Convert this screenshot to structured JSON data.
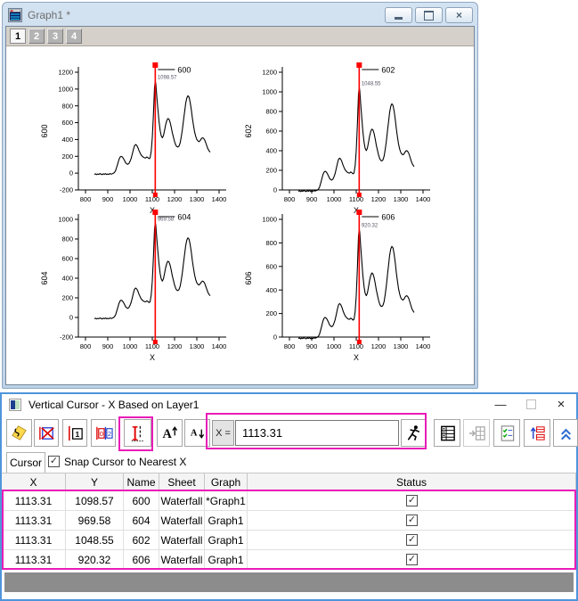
{
  "colors": {
    "highlight": "#e91cb8",
    "cursor_line": "#ff0000",
    "dialog_border": "#4f95dc"
  },
  "icons": {
    "close": "×",
    "minimize": "—",
    "check": "✓"
  },
  "graphWindow": {
    "title": "Graph1 *",
    "layerTabs": [
      "1",
      "2",
      "3",
      "4"
    ]
  },
  "chart_data": {
    "type": "line",
    "xlabel": "X",
    "xlim": [
      768,
      1432
    ],
    "xticks": [
      800,
      900,
      1000,
      1100,
      1200,
      1300,
      1400
    ],
    "cursor_x": 1113.31,
    "x": [
      840,
      845,
      850,
      855,
      860,
      865,
      870,
      875,
      880,
      885,
      890,
      895,
      900,
      905,
      910,
      915,
      920,
      925,
      930,
      935,
      940,
      945,
      950,
      955,
      960,
      965,
      970,
      975,
      980,
      985,
      990,
      995,
      1000,
      1005,
      1010,
      1015,
      1020,
      1025,
      1030,
      1035,
      1040,
      1045,
      1050,
      1055,
      1060,
      1065,
      1070,
      1075,
      1080,
      1085,
      1090,
      1095,
      1100,
      1105,
      1110,
      1113,
      1116,
      1120,
      1125,
      1130,
      1135,
      1140,
      1145,
      1150,
      1155,
      1160,
      1165,
      1170,
      1175,
      1180,
      1185,
      1190,
      1195,
      1200,
      1205,
      1210,
      1215,
      1220,
      1225,
      1230,
      1235,
      1240,
      1245,
      1250,
      1255,
      1260,
      1265,
      1270,
      1275,
      1280,
      1285,
      1290,
      1295,
      1300,
      1305,
      1310,
      1315,
      1320,
      1325,
      1330,
      1335,
      1340,
      1345,
      1350,
      1355,
      1360
    ],
    "base_y": [
      -15,
      -8,
      -18,
      -10,
      -15,
      -5,
      -12,
      -18,
      -8,
      -14,
      -6,
      -16,
      -10,
      -15,
      -5,
      -12,
      -8,
      -2,
      8,
      30,
      70,
      115,
      160,
      190,
      200,
      192,
      175,
      150,
      125,
      110,
      105,
      115,
      140,
      175,
      225,
      280,
      325,
      340,
      330,
      305,
      270,
      240,
      215,
      200,
      190,
      182,
      180,
      192,
      185,
      172,
      180,
      260,
      420,
      700,
      1020,
      1098,
      1060,
      920,
      760,
      620,
      510,
      445,
      420,
      445,
      510,
      575,
      625,
      650,
      640,
      605,
      545,
      480,
      425,
      375,
      335,
      315,
      310,
      322,
      360,
      430,
      520,
      625,
      730,
      830,
      895,
      920,
      903,
      845,
      755,
      655,
      565,
      490,
      435,
      400,
      382,
      375,
      388,
      408,
      420,
      415,
      395,
      362,
      322,
      288,
      265,
      250
    ],
    "plots": [
      {
        "name": "600",
        "ylim": [
          -200,
          1200
        ],
        "yticks": [
          -200,
          0,
          200,
          400,
          600,
          800,
          1000,
          1200
        ],
        "cursor_y": 1098.57,
        "scale": 1
      },
      {
        "name": "602",
        "ylim": [
          0,
          1200
        ],
        "yticks": [
          0,
          200,
          400,
          600,
          800,
          1000,
          1200
        ],
        "cursor_y": 1048.55,
        "scale": 0.9545
      },
      {
        "name": "604",
        "ylim": [
          -200,
          1000
        ],
        "yticks": [
          -200,
          0,
          200,
          400,
          600,
          800,
          1000
        ],
        "cursor_y": 969.58,
        "scale": 0.8826
      },
      {
        "name": "606",
        "ylim": [
          0,
          1000
        ],
        "yticks": [
          0,
          200,
          400,
          600,
          800,
          1000
        ],
        "cursor_y": 920.32,
        "scale": 0.8377
      }
    ]
  },
  "dialog": {
    "title": "Vertical Cursor - X Based on Layer1",
    "toolbar": {
      "x_label": "X =",
      "x_value": "1113.31",
      "buttons": [
        "annotation",
        "remove-label",
        "cursor-one",
        "cursor-pair",
        "vertical-cursor",
        "font-increase",
        "font-decrease",
        "go",
        "info-table",
        "output-to-worksheet",
        "preferences",
        "update-plot",
        "collapse"
      ]
    },
    "tab": "Cursor",
    "snap_label": "Snap Cursor to Nearest X",
    "snap_checked": true,
    "table": {
      "columns": [
        "X",
        "Y",
        "Name",
        "Sheet",
        "Graph",
        "Status"
      ],
      "rows": [
        {
          "x": "1113.31",
          "y": "1098.57",
          "name": "600",
          "sheet": "Waterfall",
          "graph": "*Graph1",
          "status": true
        },
        {
          "x": "1113.31",
          "y": "969.58",
          "name": "604",
          "sheet": "Waterfall",
          "graph": "Graph1",
          "status": true
        },
        {
          "x": "1113.31",
          "y": "1048.55",
          "name": "602",
          "sheet": "Waterfall",
          "graph": "Graph1",
          "status": true
        },
        {
          "x": "1113.31",
          "y": "920.32",
          "name": "606",
          "sheet": "Waterfall",
          "graph": "Graph1",
          "status": true
        }
      ]
    }
  }
}
